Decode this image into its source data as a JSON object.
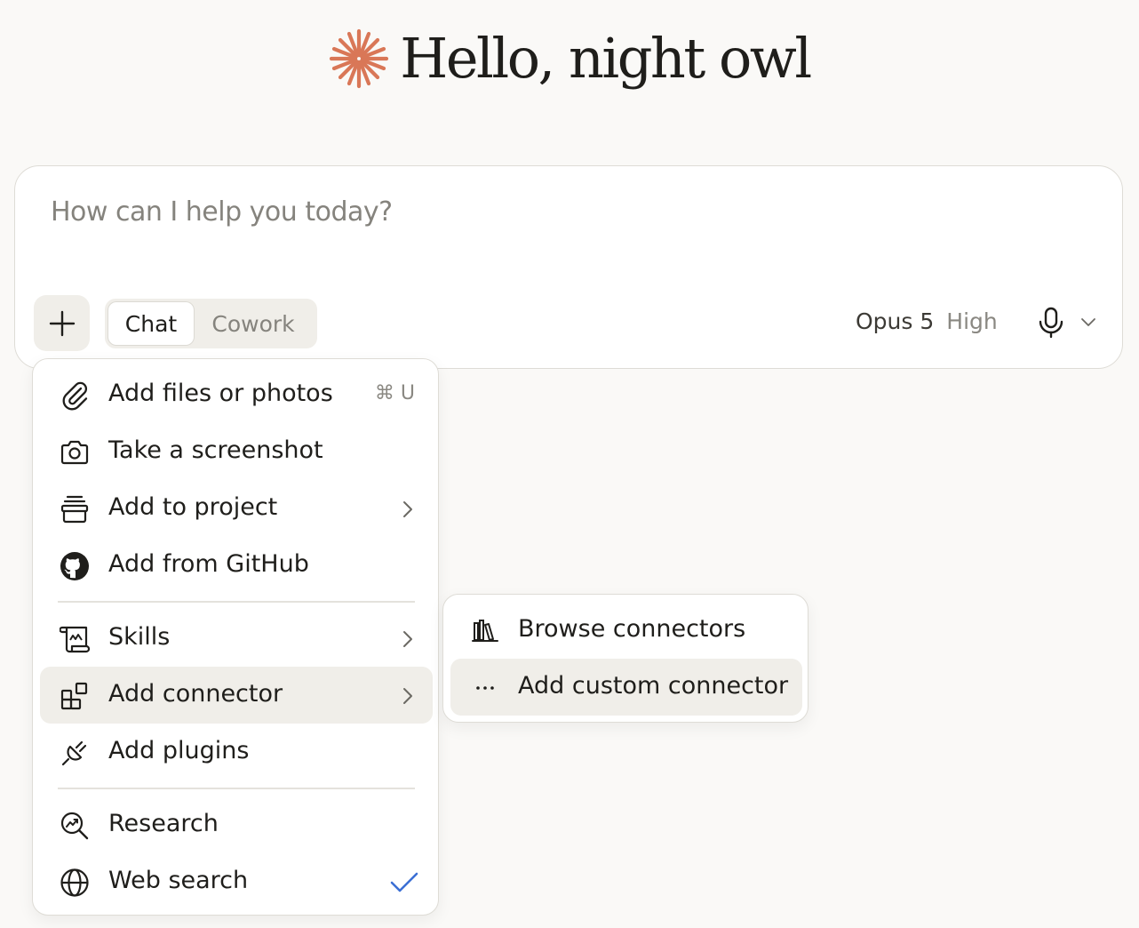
{
  "greeting": {
    "title": "Hello, night owl",
    "logo_icon": "sparkle-star-icon",
    "logo_color": "#d97757"
  },
  "composer": {
    "placeholder": "How can I help you today?",
    "plus_icon": "plus-icon",
    "modes": [
      "Chat",
      "Cowork"
    ],
    "active_mode": "Chat",
    "model_name": "Opus 5",
    "model_effort": "High",
    "mic_icon": "microphone-icon",
    "dropdown_icon": "chevron-down-icon"
  },
  "menu": {
    "items": [
      {
        "label": "Add files or photos",
        "icon": "paperclip-icon",
        "shortcut": "⌘ U"
      },
      {
        "label": "Take a screenshot",
        "icon": "camera-icon"
      },
      {
        "label": "Add to project",
        "icon": "project-box-icon",
        "has_submenu": true
      },
      {
        "label": "Add from GitHub",
        "icon": "github-icon"
      },
      {
        "label": "Skills",
        "icon": "scroll-icon",
        "has_submenu": true
      },
      {
        "label": "Add connector",
        "icon": "connector-blocks-icon",
        "has_submenu": true,
        "active": true
      },
      {
        "label": "Add plugins",
        "icon": "plug-icon"
      },
      {
        "label": "Research",
        "icon": "research-magnifier-icon"
      },
      {
        "label": "Web search",
        "icon": "globe-icon",
        "checked": true
      }
    ],
    "check_color": "#3b6fd4"
  },
  "submenu": {
    "items": [
      {
        "label": "Browse connectors",
        "icon": "library-icon"
      },
      {
        "label": "Add custom connector",
        "icon": "ellipsis-icon",
        "active": true
      }
    ]
  }
}
